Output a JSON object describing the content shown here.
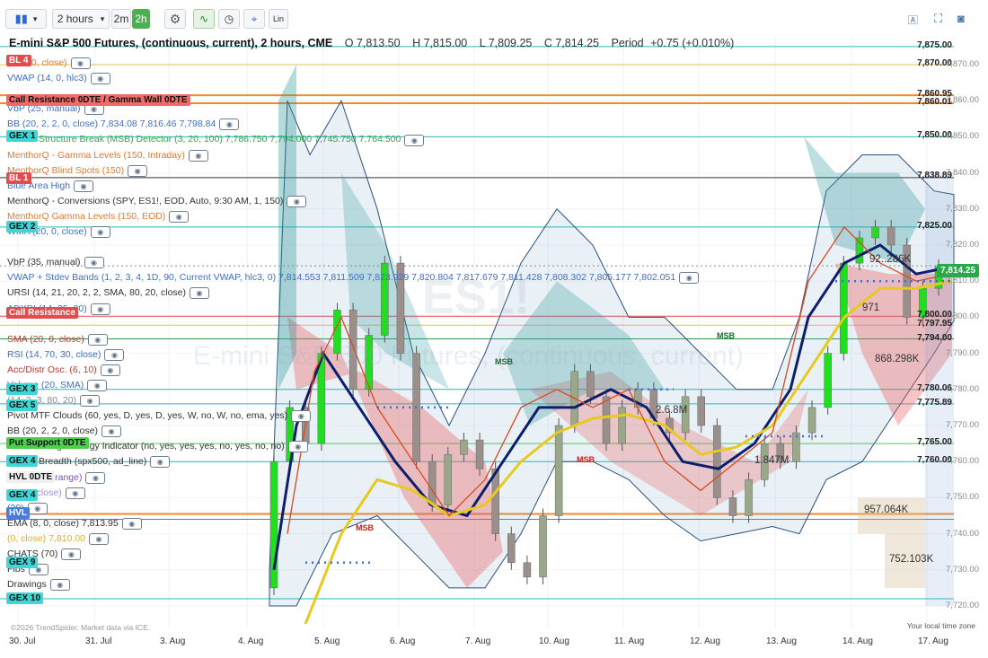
{
  "toolbar": {
    "interval_value": "2 hours",
    "interval_2m": "2m",
    "interval_2h": "2h",
    "lin_label": "Lin"
  },
  "header": {
    "title": "E-mini S&P 500 Futures, (continuous, current), 2 hours, CME",
    "open": "O 7,813.50",
    "high": "H 7,815.00",
    "low": "L 7,809.25",
    "close": "C 7,814.25",
    "period": "Period",
    "change": "+0.75 (+0.010%)"
  },
  "legend": [
    {
      "text": "(200, 0, close)",
      "color": "#e07a30"
    },
    {
      "text": "VWAP (14, 0, hlc3)",
      "color": "#3d6fc4"
    },
    {
      "text": "",
      "color": "#333"
    },
    {
      "text": "VbP (25, manual)",
      "color": "#3d6fc4"
    },
    {
      "text": "BB (20, 2, 2, 0, close)  7,834.08  7,816.46  7,798.84",
      "color": "#3d6fc4"
    },
    {
      "text": "Market Structure Break (MSB) Detector (3, 20, 100)  7,786.750  7,794.000  7,745.750  7,764.500",
      "color": "#2da84a"
    },
    {
      "text": "MenthorQ - Gamma Levels (150, Intraday)",
      "color": "#e07a30"
    },
    {
      "text": "MenthorQ Blind Spots (150)",
      "color": "#e07a30"
    },
    {
      "text": "Blue Area High",
      "color": "#3d6fc4"
    },
    {
      "text": "MenthorQ - Conversions (SPY, ES1!, EOD, Auto, 9:30 AM, 1, 150)",
      "color": "#333"
    },
    {
      "text": "MenthorQ Gamma Levels (150, EOD)",
      "color": "#e07a30"
    },
    {
      "text": "WMA (20, 0, close)",
      "color": "#3d6fc4"
    },
    {
      "text": "",
      "color": "#333"
    },
    {
      "text": "VbP (35, manual)",
      "color": "#333"
    },
    {
      "text": "VWAP + Stdev Bands (1, 2, 3, 4, 1D, 90, Current VWAP, hlc3, 0)  7,814.553  7,811.509  7,823.929  7,820.804  7,817.679  7,811.428  7,808.302  7,805.177  7,802.051",
      "color": "#3d6fc4"
    },
    {
      "text": "URSI (14, 21, 20, 2, 2, SMA, 80, 20, close)",
      "color": "#333"
    },
    {
      "text": "ADXDI (14, 35, 20)",
      "color": "#3d6fc4"
    },
    {
      "text": "",
      "color": "#333"
    },
    {
      "text": "SMA (20, 0, close)",
      "color": "#c0392b"
    },
    {
      "text": "RSI (14, 70, 30, close)",
      "color": "#3d6fc4"
    },
    {
      "text": "Acc/Distr Osc. (6, 10)",
      "color": "#c0392b"
    },
    {
      "text": "Volume (20, SMA)",
      "color": "#3d6fc4"
    },
    {
      "text": "(14, 3, 3, 80, 20)",
      "color": "#888"
    },
    {
      "text": "Pivot MTF Clouds (60, yes, D, yes, D, yes, W, no, W, no, ema, yes)",
      "color": "#333"
    },
    {
      "text": "BB (20, 2, 2, 0, close)",
      "color": "#333"
    },
    {
      "text": "ORB Trading Strategy Indicator (no, yes, yes, yes, no, yes, no, no)",
      "color": "#333"
    },
    {
      "text": "Market Breadth (spx500, ad_line)",
      "color": "#333"
    },
    {
      "text": "(25, visible range)",
      "color": "#7b4fbf"
    },
    {
      "text": "(26, 9, close)",
      "color": "#9b8fd0"
    },
    {
      "text": "(20)",
      "color": "#3d6fc4"
    },
    {
      "text": "EMA (8, 0, close)  7,813.95",
      "color": "#333"
    },
    {
      "text": "(0, close)  7,810.00",
      "color": "#e0b020"
    },
    {
      "text": "CHATS (70)",
      "color": "#333"
    },
    {
      "text": "Fibs",
      "color": "#333"
    },
    {
      "text": "Drawings",
      "color": "#333"
    }
  ],
  "tags": [
    {
      "text": "BL 4",
      "bg": "#e34c4c",
      "color": "#fff",
      "price": 7871
    },
    {
      "text": "Call Resistance 0DTE / Gamma Wall 0DTE",
      "bg": "#f06a6a",
      "color": "#111",
      "price": 7860
    },
    {
      "text": "GEX 1",
      "bg": "#3fd6d6",
      "color": "#111",
      "price": 7850
    },
    {
      "text": "BL 1",
      "bg": "#e34c4c",
      "color": "#fff",
      "price": 7838.5
    },
    {
      "text": "GEX 2",
      "bg": "#3fd6d6",
      "color": "#111",
      "price": 7825
    },
    {
      "text": "Call Resistance",
      "bg": "#e34c4c",
      "color": "#fff",
      "price": 7801
    },
    {
      "text": "GEX 3",
      "bg": "#3fd6d6",
      "color": "#111",
      "price": 7780
    },
    {
      "text": "GEX 5",
      "bg": "#3fd6d6",
      "color": "#111",
      "price": 7775.5
    },
    {
      "text": "Put Support 0DTE",
      "bg": "#4cd04c",
      "color": "#111",
      "price": 7765
    },
    {
      "text": "GEX 4",
      "bg": "#3fd6d6",
      "color": "#111",
      "price": 7760
    },
    {
      "text": "HVL 0DTE",
      "bg": "#f0f0f0",
      "color": "#111",
      "price": 7755.5
    },
    {
      "text": "GEX 4",
      "bg": "#3fd6d6",
      "color": "#111",
      "price": 7750.5
    },
    {
      "text": "HVL",
      "bg": "#4a7adb",
      "color": "#fff",
      "price": 7745.5
    },
    {
      "text": "GEX 9",
      "bg": "#3fd6d6",
      "color": "#111",
      "price": 7732
    },
    {
      "text": "GEX 10",
      "bg": "#3fd6d6",
      "color": "#111",
      "price": 7722
    }
  ],
  "price_labels": [
    {
      "text": "7,875.00",
      "price": 7875
    },
    {
      "text": "7,870.00",
      "price": 7870
    },
    {
      "text": "7,860.95",
      "price": 7861.5
    },
    {
      "text": "7,860.01",
      "price": 7859.3
    },
    {
      "text": "7,850.00",
      "price": 7850
    },
    {
      "text": "7,838.89",
      "price": 7838.9
    },
    {
      "text": "7,825.00",
      "price": 7825
    },
    {
      "text": "7,800.00",
      "price": 7800.3
    },
    {
      "text": "7,797.95",
      "price": 7797.8
    },
    {
      "text": "7,794.00",
      "price": 7794
    },
    {
      "text": "7,780.06",
      "price": 7780
    },
    {
      "text": "7,775.89",
      "price": 7776
    },
    {
      "text": "7,765.00",
      "price": 7765
    },
    {
      "text": "7,760.00",
      "price": 7760
    }
  ],
  "current_price": "7,814.25",
  "price_ticks": [
    "7,870.00",
    "7,860.00",
    "7,850.00",
    "7,840.00",
    "7,830.00",
    "7,820.00",
    "7,810.00",
    "7,800.00",
    "7,790.00",
    "7,780.00",
    "7,770.00",
    "7,760.00",
    "7,750.00",
    "7,740.00",
    "7,730.00",
    "7,720.00"
  ],
  "x_labels": [
    "30. Jul",
    "31. Jul",
    "3. Aug",
    "4. Aug",
    "5. Aug",
    "6. Aug",
    "7. Aug",
    "10. Aug",
    "11. Aug",
    "12. Aug",
    "13. Aug",
    "14. Aug",
    "17. Aug"
  ],
  "annotations": {
    "msb": "MSB",
    "vol1": "868.298K",
    "vol2": "957.064K",
    "vol3": "752.103K",
    "vol4": "2.6.8M",
    "vol5": "1.847M",
    "vol6": "92..286K",
    "vol7": "971"
  },
  "watermark": {
    "symbol": "ES1!",
    "name": "E-mini S&P 500 Futures, (continuous, current)"
  },
  "footer": {
    "copyright": "©2026 TrendSpider. Market data via ICE.",
    "timezone": "Your local time zone"
  },
  "chart_data": {
    "type": "candlestick",
    "title": "E-mini S&P 500 Futures, (continuous, current), 2 hours, CME",
    "ylim": [
      7715,
      7878
    ],
    "x_categories": [
      "30. Jul",
      "31. Jul",
      "3. Aug",
      "4. Aug",
      "5. Aug",
      "6. Aug",
      "7. Aug",
      "10. Aug",
      "11. Aug",
      "12. Aug",
      "13. Aug",
      "14. Aug",
      "17. Aug"
    ],
    "candles": [
      {
        "o": 7725,
        "c": 7760,
        "bull": true
      },
      {
        "o": 7760,
        "c": 7775,
        "bull": true
      },
      {
        "o": 7775,
        "c": 7765,
        "bull": false
      },
      {
        "o": 7765,
        "c": 7790,
        "bull": true
      },
      {
        "o": 7790,
        "c": 7802,
        "bull": true
      },
      {
        "o": 7802,
        "c": 7780,
        "bull": false
      },
      {
        "o": 7780,
        "c": 7795,
        "bull": true
      },
      {
        "o": 7795,
        "c": 7815,
        "bull": true
      },
      {
        "o": 7815,
        "c": 7790,
        "bull": false
      },
      {
        "o": 7790,
        "c": 7760,
        "bull": false
      },
      {
        "o": 7760,
        "c": 7748,
        "bull": false
      },
      {
        "o": 7748,
        "c": 7762,
        "bull": true
      },
      {
        "o": 7762,
        "c": 7766,
        "bull": true
      },
      {
        "o": 7766,
        "c": 7758,
        "bull": false
      },
      {
        "o": 7758,
        "c": 7740,
        "bull": false
      },
      {
        "o": 7740,
        "c": 7732,
        "bull": false
      },
      {
        "o": 7732,
        "c": 7728,
        "bull": false
      },
      {
        "o": 7728,
        "c": 7745,
        "bull": true
      },
      {
        "o": 7745,
        "c": 7770,
        "bull": true
      },
      {
        "o": 7770,
        "c": 7785,
        "bull": true
      },
      {
        "o": 7785,
        "c": 7778,
        "bull": false
      },
      {
        "o": 7778,
        "c": 7765,
        "bull": false
      },
      {
        "o": 7765,
        "c": 7775,
        "bull": true
      },
      {
        "o": 7775,
        "c": 7780,
        "bull": true
      },
      {
        "o": 7780,
        "c": 7772,
        "bull": false
      },
      {
        "o": 7772,
        "c": 7768,
        "bull": false
      },
      {
        "o": 7768,
        "c": 7778,
        "bull": true
      },
      {
        "o": 7778,
        "c": 7770,
        "bull": false
      },
      {
        "o": 7770,
        "c": 7750,
        "bull": false
      },
      {
        "o": 7750,
        "c": 7745,
        "bull": false
      },
      {
        "o": 7745,
        "c": 7755,
        "bull": true
      },
      {
        "o": 7755,
        "c": 7765,
        "bull": true
      },
      {
        "o": 7765,
        "c": 7760,
        "bull": false
      },
      {
        "o": 7760,
        "c": 7768,
        "bull": true
      },
      {
        "o": 7768,
        "c": 7775,
        "bull": true
      },
      {
        "o": 7775,
        "c": 7790,
        "bull": true
      },
      {
        "o": 7790,
        "c": 7815,
        "bull": true
      },
      {
        "o": 7815,
        "c": 7822,
        "bull": true
      },
      {
        "o": 7822,
        "c": 7825,
        "bull": true
      },
      {
        "o": 7825,
        "c": 7820,
        "bull": false
      },
      {
        "o": 7820,
        "c": 7800,
        "bull": false
      },
      {
        "o": 7800,
        "c": 7808,
        "bull": true
      },
      {
        "o": 7808,
        "c": 7814,
        "bull": true
      }
    ],
    "grid": true
  }
}
